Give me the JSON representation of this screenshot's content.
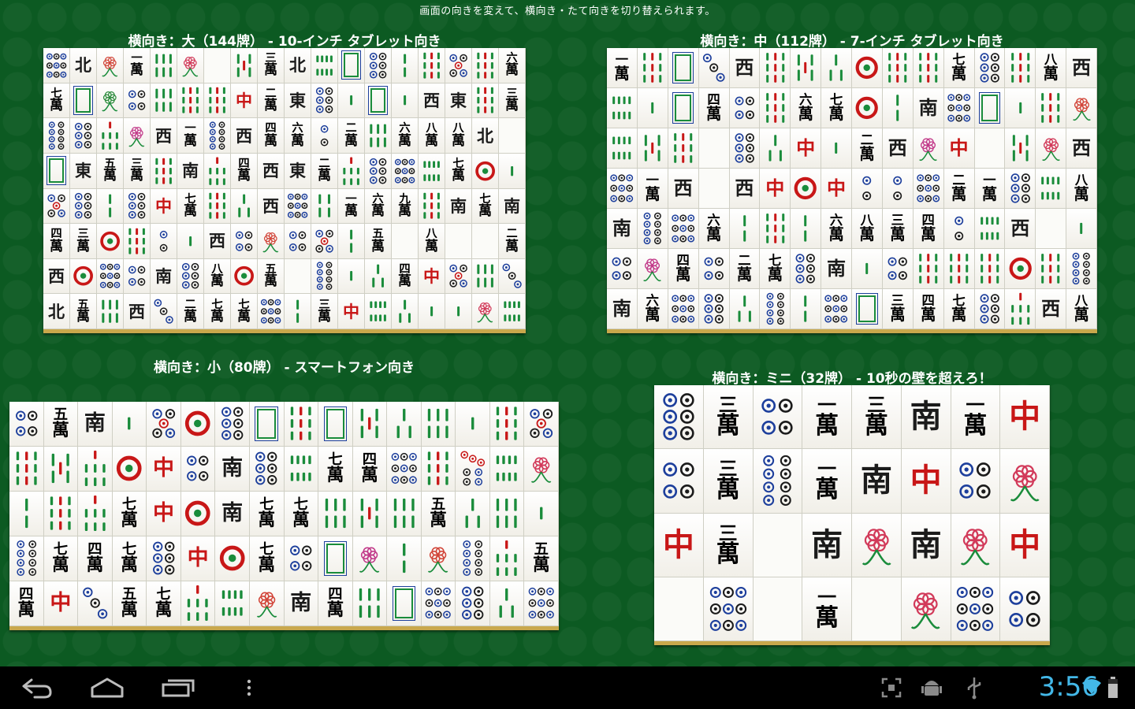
{
  "app": {
    "header_note": "画面の向きを変えて、横向き・たて向きを切り替えられます。"
  },
  "sections": [
    {
      "title": "横向き：大（144牌） - 10-インチ タブレット向き",
      "cols": 18,
      "rows": [
        "p9 n北 f菊 w1 s6 f梅 x s5 w3 n北 s8 d白 p6 s2 s9 p5 s9 w6",
        "w7 d白 f竹 p4 s6 s9 s9 d中 w2 n東 p6 s1 d白 s1 n西 n東 s9 w3",
        "p8 p6 s7 f蘭 n西 w1 p8 n西 w4 w6 p2 w2 s6 w6 w8 w8 n北 x",
        "d白 n東 w5 w3 s9 n南 s7 w4 n西 n東 w2 s7 p6 p9 s8 w7 p1 s1",
        "p5 p6 s2 p6 d中 w7 s9 s3 n西 p9 s4 w1 w6 w9 s9 n南 w7 n南",
        "w4 w3 p1 s9 p2 s1 n西 p4 f菊 p4 p5 s2 w5 x w8 x x w2",
        "n西 p1 p9 p4 n南 p6 w8 p1 w5 x p8 s1 s3 w4 d中 p5 s6 p3",
        "n北 w5 s6 n西 p3 w2 w7 w7 p9 s2 w3 d中 s8 s3 s1 s1 f梅 s8"
      ]
    },
    {
      "title": "横向き：中（112牌） - 7-インチ タブレット向き",
      "cols": 16,
      "rows": [
        "w1 s9 d白 p3 n西 s9 s5 s3 p1 s9 s9 w7 p6 s9 w8 n西",
        "s8 s1 d白 w4 p4 s9 w6 w7 p1 s2 n南 p9 d白 s1 s9 f菊",
        "s8 s5 s9 x p6 s3 d中 s1 w2 n西 f蘭 d中 x s5 f梅 n西",
        "p9 w1 n西 x n西 d中 p1 d中 p2 p2 p9 w2 w1 p6 s8 w8",
        "n南 p8 p9 w6 s2 s9 s2 w6 w8 w3 w4 p2 s8 n西 x s1",
        "p4 f蘭 w4 p4 w2 w7 p6 n南 s1 p4 s9 s9 s9 p1 s9 p8",
        "n南 w6 p9 p6 s3 p8 s2 p9 d白 w3 w4 w7 p6 s7 n西 w8"
      ]
    },
    {
      "title": "横向き：小（80牌） - スマートフォン向き",
      "cols": 16,
      "rows": [
        "p4 w5 n南 s1 p5 p1 p6 d白 s9 d白 s5 s3 s6 s1 s9 p5",
        "s9 s5 s7 p1 d中 p4 n南 p6 s8 w7 w4 p9 s9 p7 s8 f梅",
        "s2 s9 s7 w7 d中 p1 n南 w7 w7 s6 s5 s6 w5 s3 s6 s1",
        "p8 w7 w4 w7 p6 d中 p1 w7 p4 d白 f蘭 s2 f菊 p8 s7 w5",
        "w4 d中 p3 w5 w7 s7 s8 f菊 n南 w4 s6 d白 p9 p6 s3 p9"
      ]
    },
    {
      "title": "横向き：ミニ（32牌） - 10秒の壁を超えろ！",
      "cols": 8,
      "rows": [
        "p6 w3 p4 w1 w3 n南 w1 d中",
        "p4 w3 p8 w1 n南 d中 p4 f梅",
        "d中 w3 x n南 f梅 n南 f梅 d中",
        "x p9 x w1 x f梅 p9 p4"
      ]
    }
  ],
  "navigation": {
    "back_icon": "back-arrow-icon",
    "home_icon": "home-icon",
    "recent_icon": "recent-apps-icon",
    "menu_icon": "overflow-menu-icon"
  },
  "status": {
    "time": "3:56",
    "icons": [
      "screenshot-icon",
      "android-debug-icon",
      "usb-icon",
      "wifi-icon",
      "battery-icon"
    ]
  }
}
